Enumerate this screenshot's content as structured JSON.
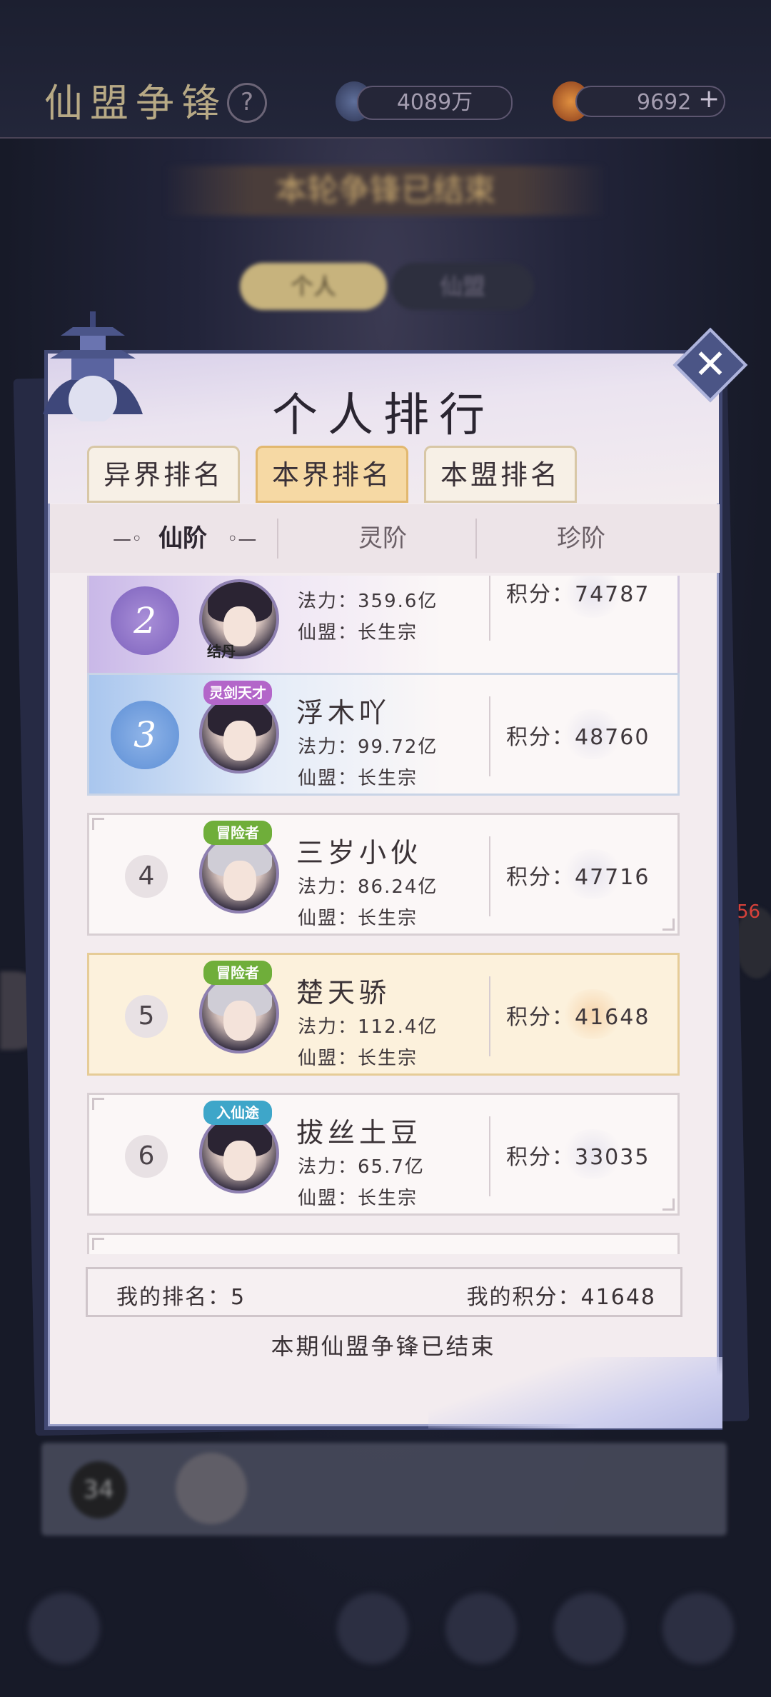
{
  "background": {
    "title": "仙盟争锋",
    "help": "?",
    "currency_1": "4089万",
    "currency_2": "9692",
    "currency_2_add": "+",
    "banner": "本轮争锋已结束",
    "tab_left": "个人",
    "tab_right": "仙盟",
    "side_badge": "56",
    "bottom_rank": "34"
  },
  "popup": {
    "title": "个人排行",
    "close": "✕",
    "category_tabs": [
      {
        "label": "异界排名",
        "active": false
      },
      {
        "label": "本界排名",
        "active": true
      },
      {
        "label": "本盟排名",
        "active": false
      }
    ],
    "sub_tabs": [
      {
        "label": "仙阶",
        "active": true
      },
      {
        "label": "灵阶",
        "active": false
      },
      {
        "label": "珍阶",
        "active": false
      }
    ],
    "rows": [
      {
        "rank": "2",
        "name": "",
        "badge": "结丹",
        "power": "法力：359.6亿",
        "guild": "仙盟：长生宗",
        "score": "积分：74787"
      },
      {
        "rank": "3",
        "name": "浮木吖",
        "badge": "灵剑天才",
        "power": "法力：99.72亿",
        "guild": "仙盟：长生宗",
        "score": "积分：48760"
      },
      {
        "rank": "4",
        "name": "三岁小伙",
        "badge": "冒险者",
        "power": "法力：86.24亿",
        "guild": "仙盟：长生宗",
        "score": "积分：47716"
      },
      {
        "rank": "5",
        "name": "楚天骄",
        "badge": "冒险者",
        "power": "法力：112.4亿",
        "guild": "仙盟：长生宗",
        "score": "积分：41648"
      },
      {
        "rank": "6",
        "name": "拔丝土豆",
        "badge": "入仙途",
        "power": "法力：65.7亿",
        "guild": "仙盟：长生宗",
        "score": "积分：33035"
      }
    ],
    "my_rank": "我的排名：5",
    "my_score": "我的积分：41648",
    "ended_text": "本期仙盟争锋已结束"
  },
  "colors": {
    "panel_border": "#434a75",
    "active_tab": "#f6d9a4",
    "my_row": "#fcf1dc"
  }
}
